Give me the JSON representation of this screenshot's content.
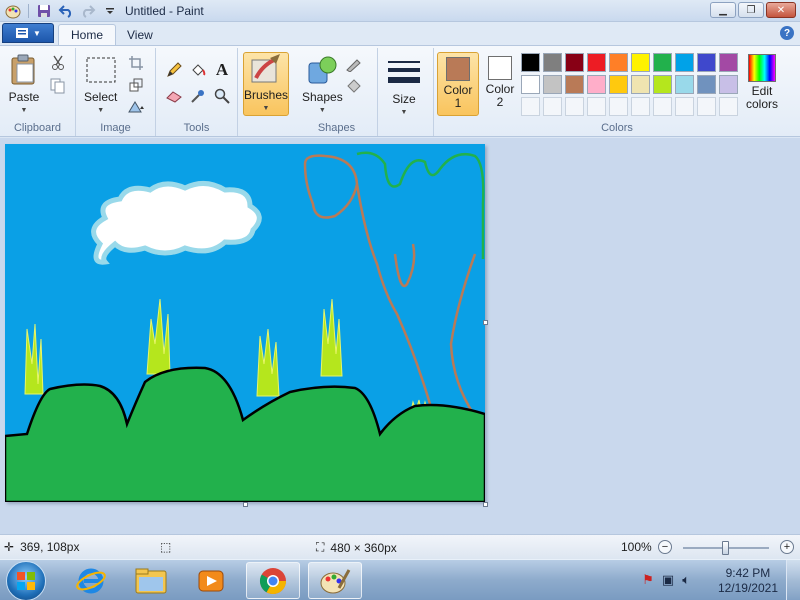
{
  "window": {
    "title": "Untitled - Paint"
  },
  "tabs": {
    "home": "Home",
    "view": "View"
  },
  "ribbon": {
    "clipboard": {
      "label": "Clipboard",
      "paste": "Paste"
    },
    "image": {
      "label": "Image",
      "select": "Select"
    },
    "tools": {
      "label": "Tools"
    },
    "brushes": {
      "label": "Brushes"
    },
    "shapes": {
      "label": "Shapes",
      "button": "Shapes"
    },
    "size": {
      "label": "Size"
    },
    "colors": {
      "label": "Colors",
      "color1_label": "Color\n1",
      "color1_line1": "Color",
      "color1_line2": "1",
      "color2_line1": "Color",
      "color2_line2": "2",
      "edit_line1": "Edit",
      "edit_line2": "colors",
      "color1_value": "#b97a57",
      "color2_value": "#ffffff",
      "palette": [
        "#000000",
        "#7f7f7f",
        "#880015",
        "#ed1c24",
        "#ff7f27",
        "#fff200",
        "#22b14c",
        "#00a2e8",
        "#3f48cc",
        "#a349a4",
        "#ffffff",
        "#c3c3c3",
        "#b97a57",
        "#ffaec9",
        "#ffc90e",
        "#efe4b0",
        "#b5e61d",
        "#99d9ea",
        "#7092be",
        "#c8bfe7",
        "",
        "",
        "",
        "",
        "",
        "",
        "",
        "",
        "",
        ""
      ]
    }
  },
  "canvas": {
    "sky_color": "#0aa0e6",
    "ground_color": "#22b14c",
    "trunk_color": "#b97a57",
    "leaf_color": "#22b14c"
  },
  "status": {
    "cursor_position": "369, 108px",
    "image_size": "480 × 360px",
    "zoom": "100%"
  },
  "taskbar": {
    "apps": [
      "internet-explorer-icon",
      "file-explorer-icon",
      "media-player-icon",
      "chrome-icon",
      "paint-icon"
    ],
    "clock_time": "9:42 PM",
    "clock_date": "12/19/2021"
  }
}
